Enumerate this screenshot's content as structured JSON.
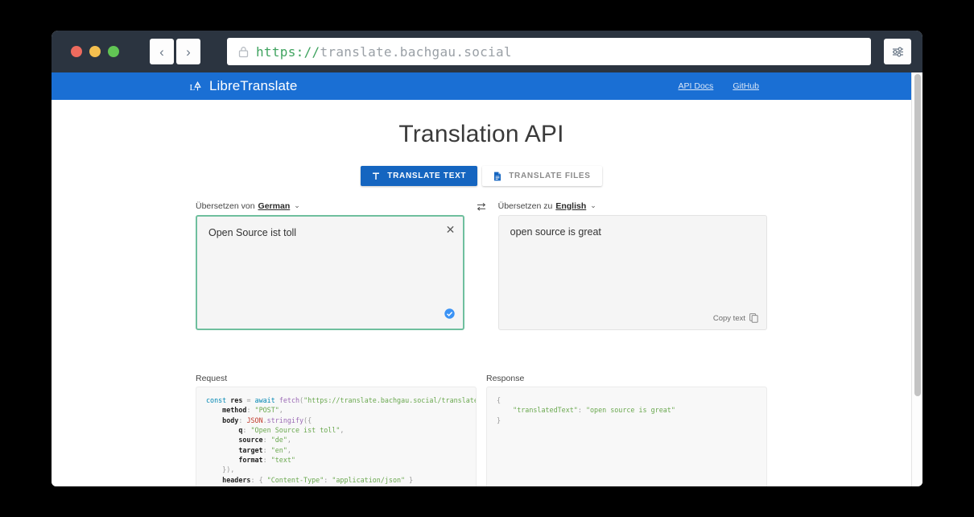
{
  "browser": {
    "back_label": "‹",
    "forward_label": "›",
    "url_scheme": "https://",
    "url_host": "translate.bachgau.social",
    "lock_icon": "lock-icon",
    "prefs_icon": "sliders-icon",
    "traffic_lights": [
      "close-red",
      "minimize-yellow",
      "maximize-green"
    ]
  },
  "navbar": {
    "brand": "LibreTranslate",
    "brand_icon": "libretranslate-logo-icon",
    "links": [
      {
        "label": "API Docs"
      },
      {
        "label": "GitHub"
      }
    ],
    "background_color": "#1a6fd4"
  },
  "main": {
    "title": "Translation API",
    "tabs": [
      {
        "label": "TRANSLATE TEXT",
        "icon": "text-t-icon",
        "active": true
      },
      {
        "label": "TRANSLATE FILES",
        "icon": "file-document-icon",
        "active": false
      }
    ],
    "source": {
      "label_prefix": "Übersetzen von",
      "language": "German",
      "chevron": "⌄",
      "text": "Open Source ist toll",
      "clear_icon": "close-x-icon",
      "status_icon": "check-circle-icon"
    },
    "swap_icon": "swap-horizontal-icon",
    "target": {
      "label_prefix": "Übersetzen zu",
      "language": "English",
      "chevron": "⌄",
      "text": "open source is great",
      "copy_label": "Copy text",
      "copy_icon": "copy-icon"
    },
    "request": {
      "label": "Request",
      "lines": [
        "const res = await fetch(\"https://translate.bachgau.social/translate\", {",
        "    method: \"POST\",",
        "    body: JSON.stringify({",
        "        q: \"Open Source ist toll\",",
        "        source: \"de\",",
        "        target: \"en\",",
        "        format: \"text\"",
        "    }),",
        "    headers: { \"Content-Type\": \"application/json\" }",
        "});"
      ]
    },
    "response": {
      "label": "Response",
      "lines": [
        "{",
        "    \"translatedText\": \"open source is great\"",
        "}"
      ]
    }
  },
  "colors": {
    "accent": "#1a6fd4",
    "tab_active": "#1565c0",
    "source_border": "#6fbf9e",
    "url_green": "#3fa35f"
  }
}
